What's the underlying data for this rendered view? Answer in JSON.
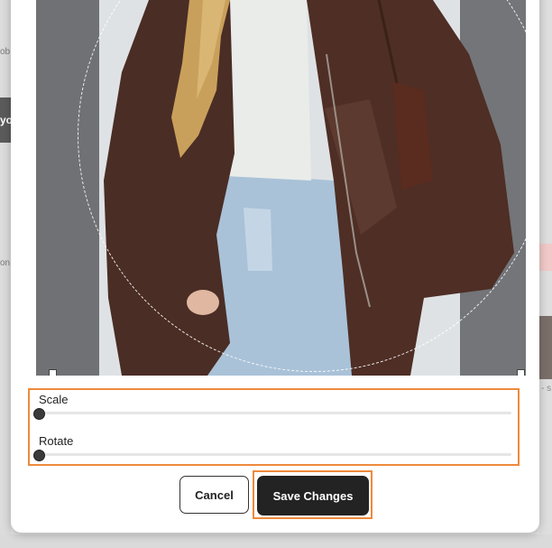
{
  "background": {
    "left_fragments": [
      "ob",
      "yo",
      "on"
    ],
    "right_fragment": "- s"
  },
  "editor": {
    "photo_alt": "Person in brown leather jacket and light blue jeans",
    "sliders": [
      {
        "label": "Scale",
        "value": 0
      },
      {
        "label": "Rotate",
        "value": 0
      }
    ],
    "buttons": {
      "cancel": "Cancel",
      "save": "Save Changes"
    },
    "colors": {
      "highlight": "#ee8a3c",
      "save_bg": "#232323"
    }
  }
}
